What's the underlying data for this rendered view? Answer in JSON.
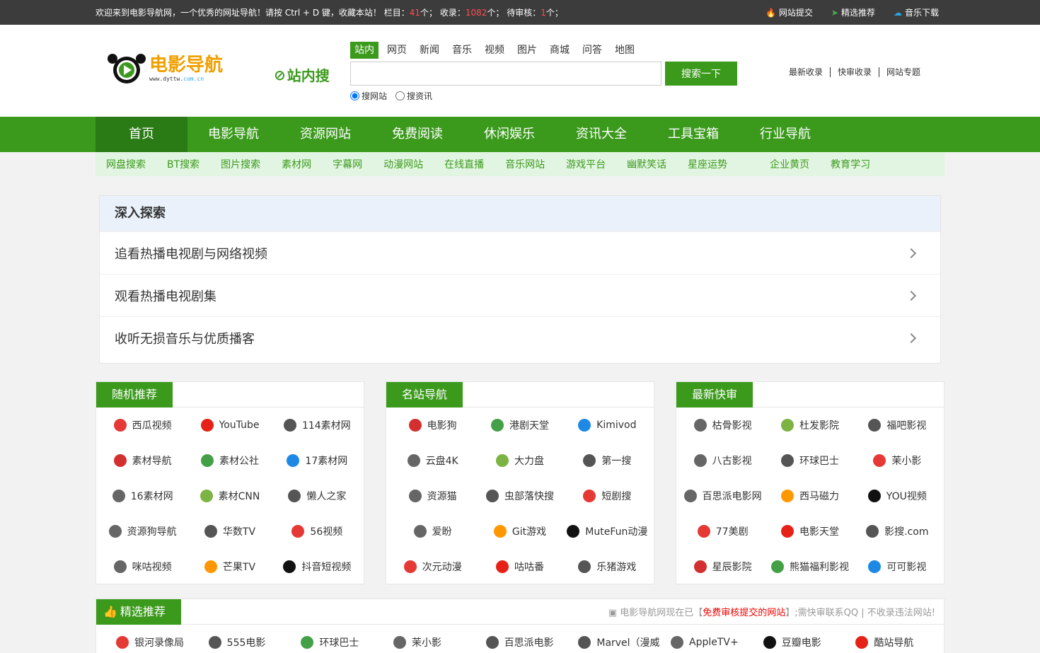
{
  "topbar": {
    "welcome": "欢迎来到电影导航网，一个优秀的网址导航！请按 Ctrl + D 键，收藏本站！",
    "col_label": " 栏目：",
    "col_count": "41",
    "col_unit": "个； 收录：",
    "inc_count": "1082",
    "inc_unit": "个； 待审核：",
    "pend_count": "1",
    "pend_unit": "个；",
    "links": [
      "网站提交",
      "精选推荐",
      "音乐下载"
    ]
  },
  "logo": {
    "title": "电影导航",
    "sub1": "www.dyttw.",
    "sub2": "com.cn"
  },
  "zhannei": "站内搜",
  "search": {
    "tabs": [
      "站内",
      "网页",
      "新闻",
      "音乐",
      "视频",
      "图片",
      "商城",
      "问答",
      "地图"
    ],
    "button": "搜索一下",
    "placeholder": "",
    "radios": [
      "搜网站",
      "搜资讯"
    ]
  },
  "right_links": [
    "最新收录",
    "快审收录",
    "网站专题"
  ],
  "nav": [
    "首页",
    "电影导航",
    "资源网站",
    "免费阅读",
    "休闲娱乐",
    "资讯大全",
    "工具宝箱",
    "行业导航"
  ],
  "subnav": [
    "网盘搜索",
    "BT搜索",
    "图片搜索",
    "素材网",
    "字幕网",
    "动漫网站",
    "在线直播",
    "音乐网站",
    "游戏平台",
    "幽默笑话",
    "星座运势",
    "企业黄页",
    "教育学习"
  ],
  "explore": {
    "title": "深入探索",
    "rows": [
      "追看热播电视剧与网络视频",
      "观看热播电视剧集",
      "收听无损音乐与优质播客"
    ]
  },
  "panels": [
    {
      "title": "随机推荐",
      "items": [
        "西瓜视频",
        "YouTube",
        "114素材网",
        "素材导航",
        "素材公社",
        "17素材网",
        "16素材网",
        "素材CNN",
        "懒人之家",
        "资源狗导航",
        "华数TV",
        "56视频",
        "咪咕视频",
        "芒果TV",
        "抖音短视频"
      ]
    },
    {
      "title": "名站导航",
      "items": [
        "电影狗",
        "港剧天堂",
        "Kimivod",
        "云盘4K",
        "大力盘",
        "第一搜",
        "资源猫",
        "虫部落快搜",
        "短剧搜",
        "爱盼",
        "Git游戏",
        "MuteFun动漫",
        "次元动漫",
        "咕咕番",
        "乐猪游戏"
      ]
    },
    {
      "title": "最新快审",
      "items": [
        "枯骨影视",
        "杜发影院",
        "福吧影视",
        "八古影视",
        "环球巴士",
        "茉小影",
        "百思派电影网",
        "西马磁力",
        "YOU视频",
        "77美剧",
        "电影天堂",
        "影搜.com",
        "星辰影院",
        "熊猫福利影视",
        "可可影视"
      ]
    }
  ],
  "featured": {
    "title": "精选推荐",
    "notice_a": "电影导航网现在已【",
    "notice_b": "免费审核提交的网站",
    "notice_c": "】;需快审联系QQ | 不收录违法网站!",
    "items": [
      "银河录像局",
      "555电影",
      "环球巴士",
      "茉小影",
      "百思派电影",
      "Marvel（漫威",
      "AppleTV+",
      "豆瓣电影",
      "酷站导航"
    ]
  },
  "colors": {
    "green": "#3b9a1c",
    "dark": "#3c3c3c",
    "red": "#ff4d4d"
  }
}
